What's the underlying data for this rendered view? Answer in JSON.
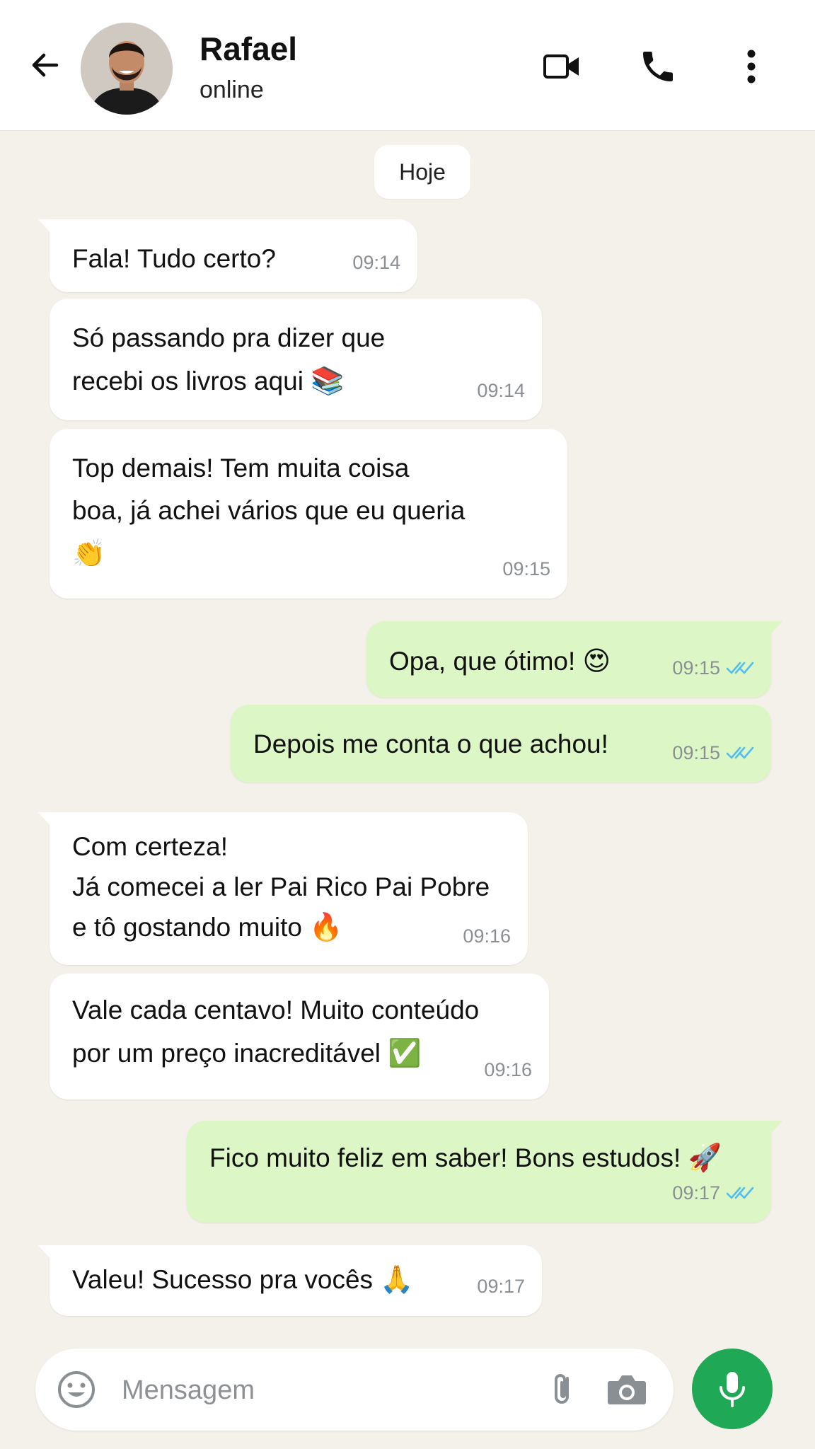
{
  "header": {
    "contact_name": "Rafael",
    "status": "online",
    "back_icon": "arrow-left-icon",
    "video_icon": "video-camera-icon",
    "call_icon": "phone-icon",
    "menu_icon": "more-vertical-icon"
  },
  "chat": {
    "date_label": "Hoje",
    "messages": [
      {
        "direction": "in",
        "text": "Fala! Tudo certo?",
        "time": "09:14"
      },
      {
        "direction": "in",
        "text": "Só passando pra dizer que\nrecebi os livros aqui",
        "emoji": "📚",
        "time": "09:14"
      },
      {
        "direction": "in",
        "text": "Top demais! Tem muita coisa\nboa, já achei vários que eu queria\n",
        "emoji": "👏",
        "time": "09:15"
      },
      {
        "direction": "out",
        "text": "Opa, que ótimo!",
        "emoji": "😍",
        "time": "09:15",
        "status": "read"
      },
      {
        "direction": "out",
        "text": "Depois me conta o que achou!",
        "time": "09:15",
        "status": "read"
      },
      {
        "direction": "in",
        "text": "Com certeza!\nJá comecei a ler Pai Rico Pai Pobre\ne tô gostando muito",
        "emoji": "🔥",
        "time": "09:16"
      },
      {
        "direction": "in",
        "text": "Vale cada centavo! Muito conteúdo\npor um preço inacreditável",
        "emoji": "✅",
        "time": "09:16"
      },
      {
        "direction": "out",
        "text": "Fico muito feliz em saber! Bons estudos!",
        "emoji": "🚀",
        "time": "09:17",
        "status": "read"
      },
      {
        "direction": "in",
        "text": "Valeu! Sucesso pra vocês",
        "emoji": "🙏",
        "time": "09:17"
      }
    ]
  },
  "composer": {
    "placeholder": "Mensagem",
    "emoji_icon": "smiley-icon",
    "attach_icon": "paperclip-icon",
    "camera_icon": "camera-icon",
    "mic_icon": "microphone-icon"
  },
  "colors": {
    "background": "#f4f1ea",
    "incoming_bubble": "#ffffff",
    "outgoing_bubble": "#dcf7c5",
    "read_ticks": "#53bdeb",
    "mic_button": "#1fa855"
  }
}
